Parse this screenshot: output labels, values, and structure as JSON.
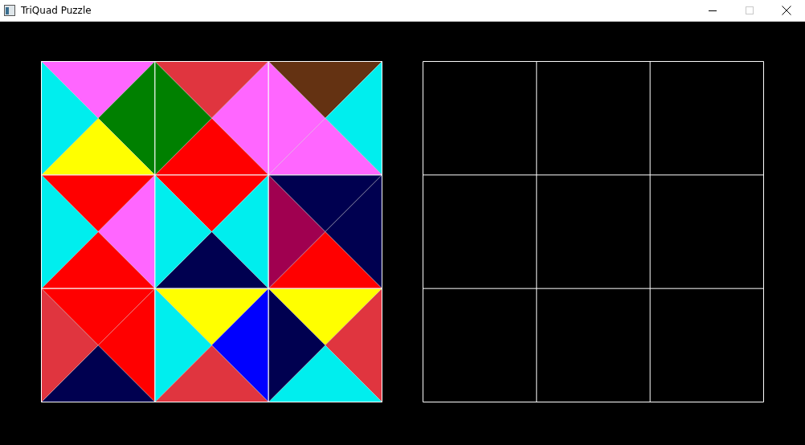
{
  "window": {
    "title": "TriQuad Puzzle",
    "maximize_disabled": true
  },
  "board": {
    "tiles": [
      {
        "triangles": [
          {
            "color": "#ff66ff"
          },
          {
            "color": "#008000"
          },
          {
            "color": "#ffff00"
          },
          {
            "color": "#00eeee"
          }
        ]
      },
      {
        "triangles": [
          {
            "color": "#e0353f"
          },
          {
            "color": "#ff66ff"
          },
          {
            "color": "#ff0000"
          },
          {
            "color": "#008000"
          }
        ]
      },
      {
        "triangles": [
          {
            "color": "#643212"
          },
          {
            "color": "#00eeee"
          },
          {
            "color": "#ff66ff"
          },
          {
            "color": "#ff66ff"
          }
        ]
      },
      {
        "triangles": [
          {
            "color": "#ff0000"
          },
          {
            "color": "#ff66ff"
          },
          {
            "color": "#ff0000"
          },
          {
            "color": "#00eeee"
          }
        ]
      },
      {
        "triangles": [
          {
            "color": "#ff0000"
          },
          {
            "color": "#00eeee"
          },
          {
            "color": "#000050"
          },
          {
            "color": "#00eeee"
          }
        ]
      },
      {
        "triangles": [
          {
            "color": "#000050"
          },
          {
            "color": "#000050"
          },
          {
            "color": "#ff0000"
          },
          {
            "color": "#a00050"
          }
        ]
      },
      {
        "triangles": [
          {
            "color": "#ff0000"
          },
          {
            "color": "#ff0000"
          },
          {
            "color": "#000050"
          },
          {
            "color": "#e0353f"
          }
        ]
      },
      {
        "triangles": [
          {
            "color": "#ffff00"
          },
          {
            "color": "#0000ff"
          },
          {
            "color": "#e0353f"
          },
          {
            "color": "#00eeee"
          }
        ]
      },
      {
        "triangles": [
          {
            "color": "#ffff00"
          },
          {
            "color": "#e0353f"
          },
          {
            "color": "#00eeee"
          },
          {
            "color": "#000050"
          }
        ]
      }
    ]
  }
}
